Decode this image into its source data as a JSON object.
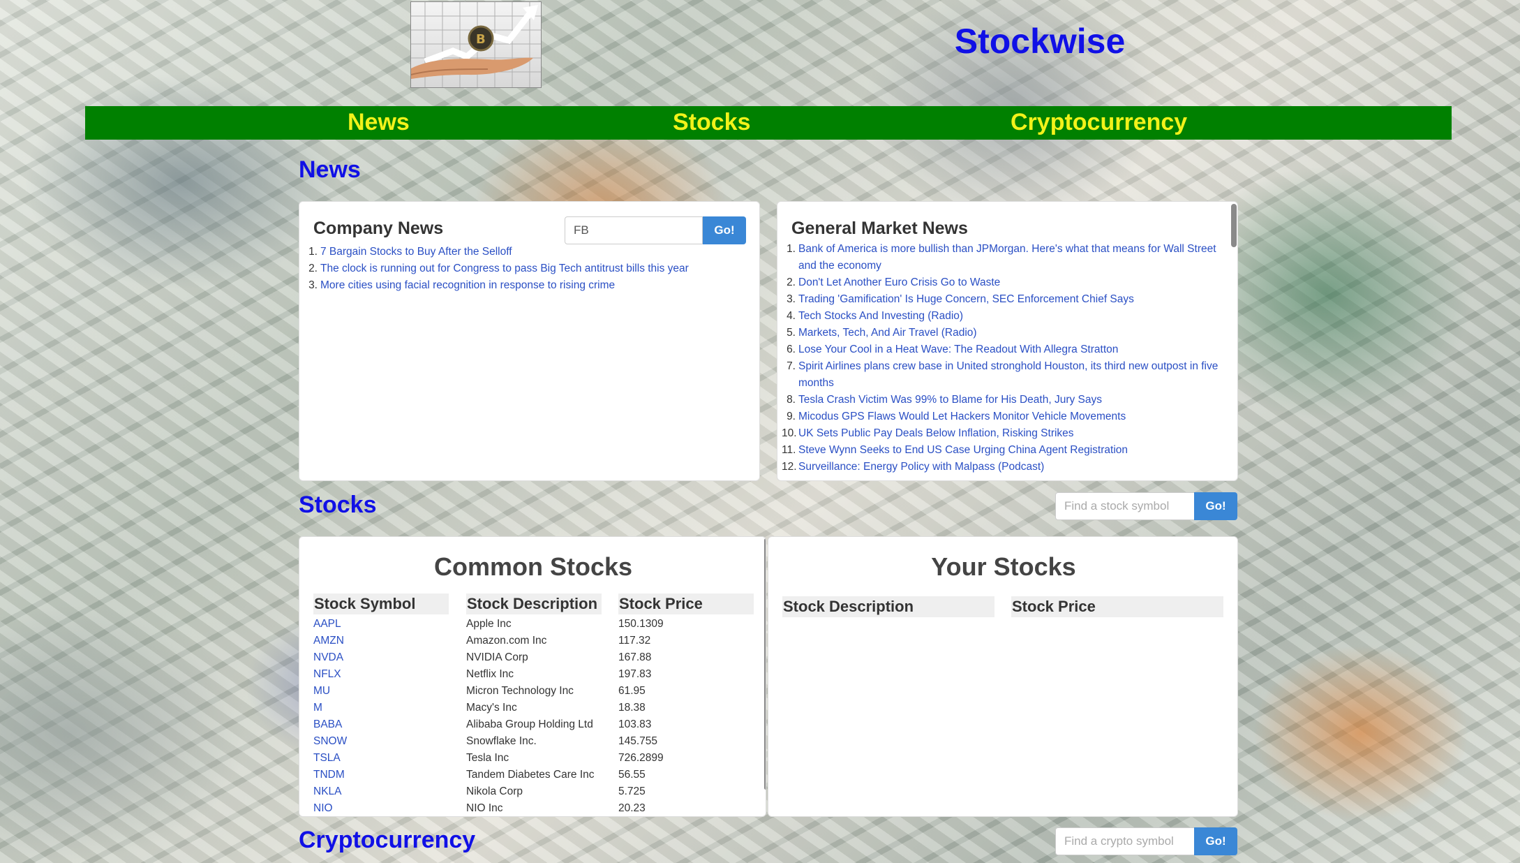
{
  "site": {
    "title": "Stockwise",
    "logo_icon": "bitcoin-growth-hand-logo"
  },
  "nav": [
    {
      "label": "News"
    },
    {
      "label": "Stocks"
    },
    {
      "label": "Cryptocurrency"
    }
  ],
  "news": {
    "heading": "News",
    "company": {
      "title": "Company News",
      "input_value": "FB",
      "go_label": "Go!",
      "items": [
        "7 Bargain Stocks to Buy After the Selloff",
        "The clock is running out for Congress to pass Big Tech antitrust bills this year",
        "More cities using facial recognition in response to rising crime"
      ]
    },
    "general": {
      "title": "General Market News",
      "items": [
        "Bank of America is more bullish than JPMorgan. Here's what that means for Wall Street and the economy",
        "Don't Let Another Euro Crisis Go to Waste",
        "Trading 'Gamification' Is Huge Concern, SEC Enforcement Chief Says",
        "Tech Stocks And Investing (Radio)",
        "Markets, Tech, And Air Travel (Radio)",
        "Lose Your Cool in a Heat Wave: The Readout With Allegra Stratton",
        "Spirit Airlines plans crew base in United stronghold Houston, its third new outpost in five months",
        "Tesla Crash Victim Was 99% to Blame for His Death, Jury Says",
        "Micodus GPS Flaws Would Let Hackers Monitor Vehicle Movements",
        "UK Sets Public Pay Deals Below Inflation, Risking Strikes",
        "Steve Wynn Seeks to End US Case Urging China Agent Registration",
        "Surveillance: Energy Policy with Malpass (Podcast)"
      ]
    }
  },
  "stocks": {
    "heading": "Stocks",
    "search_placeholder": "Find a stock symbol",
    "go_label": "Go!",
    "common": {
      "title": "Common Stocks",
      "columns": [
        "Stock Symbol",
        "Stock Description",
        "Stock Price"
      ],
      "rows": [
        [
          "AAPL",
          "Apple Inc",
          "150.1309"
        ],
        [
          "AMZN",
          "Amazon.com Inc",
          "117.32"
        ],
        [
          "NVDA",
          "NVIDIA Corp",
          "167.88"
        ],
        [
          "NFLX",
          "Netflix Inc",
          "197.83"
        ],
        [
          "MU",
          "Micron Technology Inc",
          "61.95"
        ],
        [
          "M",
          "Macy's Inc",
          "18.38"
        ],
        [
          "BABA",
          "Alibaba Group Holding Ltd",
          "103.83"
        ],
        [
          "SNOW",
          "Snowflake Inc.",
          "145.755"
        ],
        [
          "TSLA",
          "Tesla Inc",
          "726.2899"
        ],
        [
          "TNDM",
          "Tandem Diabetes Care Inc",
          "56.55"
        ],
        [
          "NKLA",
          "Nikola Corp",
          "5.725"
        ],
        [
          "NIO",
          "NIO Inc",
          "20.23"
        ]
      ]
    },
    "yours": {
      "title": "Your Stocks",
      "columns": [
        "Stock Description",
        "Stock Price"
      ]
    }
  },
  "crypto": {
    "heading": "Cryptocurrency",
    "search_placeholder": "Find a crypto symbol",
    "go_label": "Go!"
  },
  "colors": {
    "nav_bg": "#008000",
    "nav_text": "#f2f21a",
    "heading": "#1010e6",
    "link": "#2a4fc4",
    "button": "#3a87d6"
  }
}
